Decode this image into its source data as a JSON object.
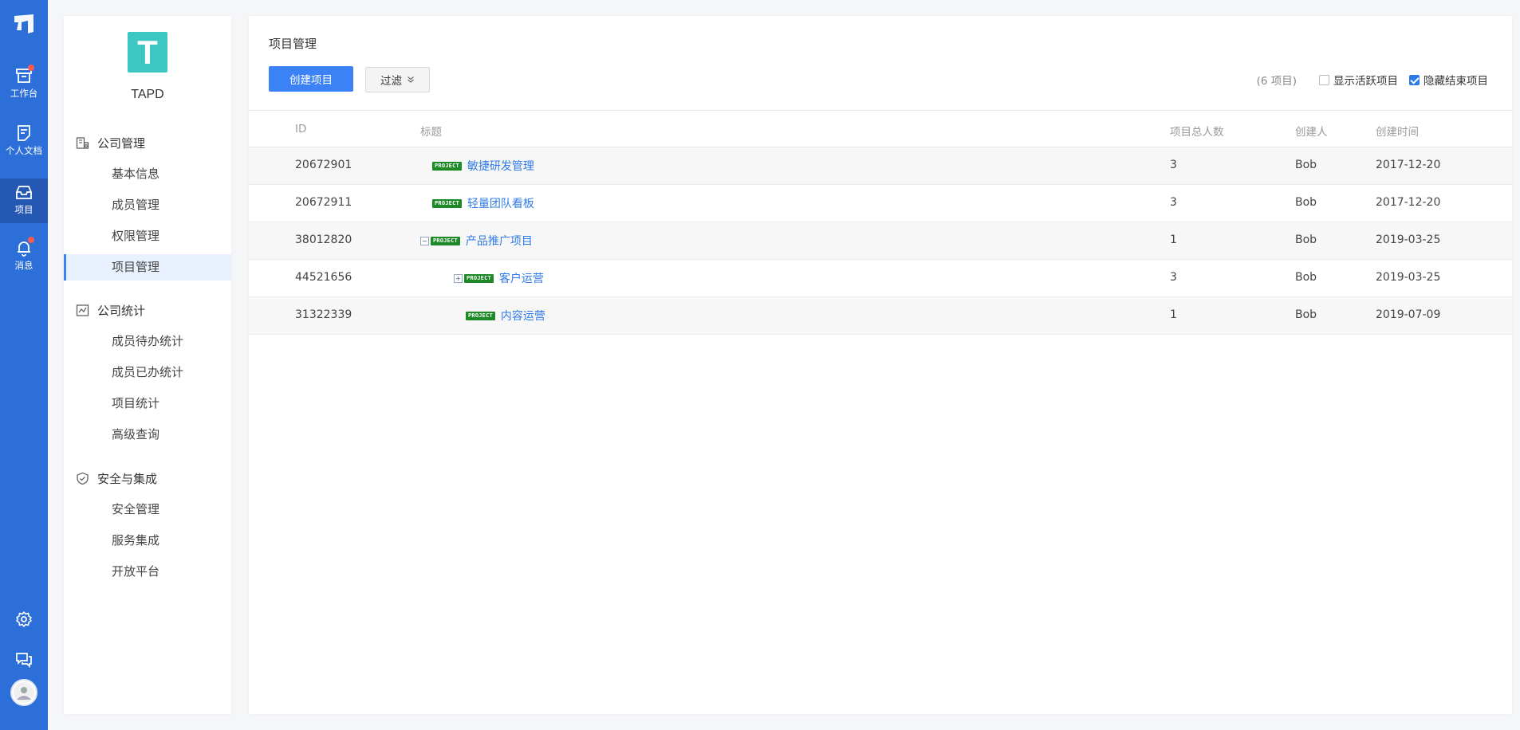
{
  "rail": {
    "items": [
      {
        "label": "工作台",
        "icon": "workbench-icon",
        "badge": true
      },
      {
        "label": "个人文档",
        "icon": "document-icon",
        "badge": false
      },
      {
        "label": "项目",
        "icon": "project-icon",
        "badge": false,
        "active": true
      },
      {
        "label": "消息",
        "icon": "bell-icon",
        "badge": true
      }
    ],
    "bottom": [
      "gear-icon",
      "chat-icon",
      "avatar"
    ]
  },
  "sidebar": {
    "brand_letter": "T",
    "brand_name": "TAPD",
    "groups": [
      {
        "title": "公司管理",
        "icon": "company-icon",
        "items": [
          "基本信息",
          "成员管理",
          "权限管理",
          "项目管理"
        ]
      },
      {
        "title": "公司统计",
        "icon": "chart-icon",
        "items": [
          "成员待办统计",
          "成员已办统计",
          "项目统计",
          "高级查询"
        ]
      },
      {
        "title": "安全与集成",
        "icon": "shield-icon",
        "items": [
          "安全管理",
          "服务集成",
          "开放平台"
        ]
      }
    ],
    "active_item": "项目管理"
  },
  "main": {
    "title": "项目管理",
    "create_button": "创建项目",
    "filter_button": "过滤",
    "count": "(6 项目)",
    "show_active_label": "显示活跃项目",
    "show_active_checked": false,
    "hide_closed_label": "隐藏结束项目",
    "hide_closed_checked": true,
    "columns": {
      "id": "ID",
      "title": "标题",
      "members": "项目总人数",
      "creator": "创建人",
      "created": "创建时间"
    },
    "tag_label": "PROJECT",
    "rows": [
      {
        "id": "20672901",
        "title": "敏捷研发管理",
        "members": "3",
        "creator": "Bob",
        "created": "2017-12-20",
        "level": 0,
        "toggle": ""
      },
      {
        "id": "20672911",
        "title": "轻量团队看板",
        "members": "3",
        "creator": "Bob",
        "created": "2017-12-20",
        "level": 0,
        "toggle": ""
      },
      {
        "id": "38012820",
        "title": "产品推广项目",
        "members": "1",
        "creator": "Bob",
        "created": "2019-03-25",
        "level": 0,
        "toggle": "minus"
      },
      {
        "id": "44521656",
        "title": "客户运营",
        "members": "3",
        "creator": "Bob",
        "created": "2019-03-25",
        "level": 1,
        "toggle": "plus"
      },
      {
        "id": "31322339",
        "title": "内容运营",
        "members": "1",
        "creator": "Bob",
        "created": "2019-07-09",
        "level": 1,
        "toggle": ""
      }
    ]
  }
}
